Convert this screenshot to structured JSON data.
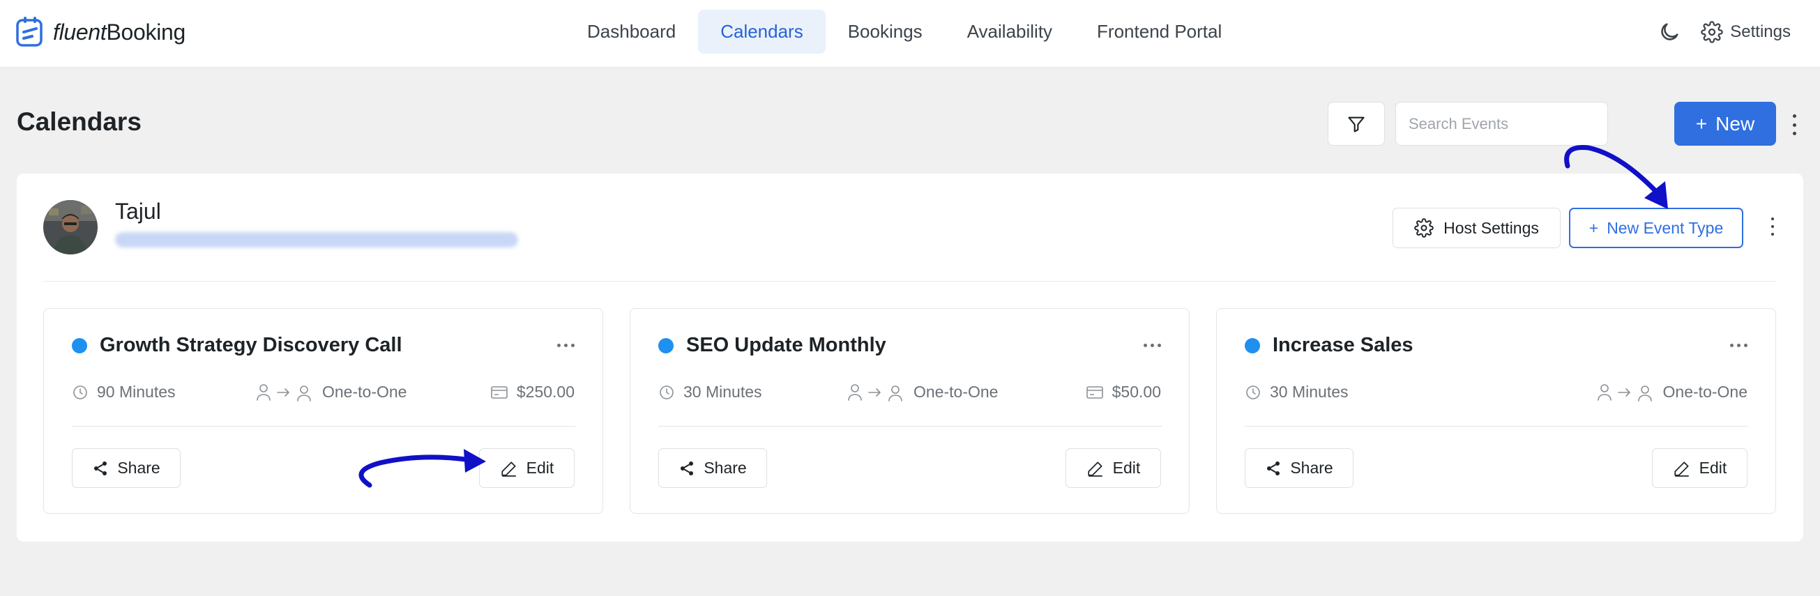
{
  "brand": {
    "name_part1": "fluent",
    "name_part2": "Booking"
  },
  "nav": {
    "items": [
      {
        "label": "Dashboard",
        "active": false
      },
      {
        "label": "Calendars",
        "active": true
      },
      {
        "label": "Bookings",
        "active": false
      },
      {
        "label": "Availability",
        "active": false
      },
      {
        "label": "Frontend Portal",
        "active": false
      }
    ],
    "settings_label": "Settings"
  },
  "page": {
    "title": "Calendars",
    "search_placeholder": "Search Events",
    "new_label": "New"
  },
  "host": {
    "name": "Tajul",
    "host_settings_label": "Host Settings",
    "new_event_type_label": "New Event Type"
  },
  "events": [
    {
      "title": "Growth Strategy Discovery Call",
      "duration": "90 Minutes",
      "type": "One-to-One",
      "price": "$250.00",
      "share_label": "Share",
      "edit_label": "Edit"
    },
    {
      "title": "SEO Update Monthly",
      "duration": "30 Minutes",
      "type": "One-to-One",
      "price": "$50.00",
      "share_label": "Share",
      "edit_label": "Edit"
    },
    {
      "title": "Increase Sales",
      "duration": "30 Minutes",
      "type": "One-to-One",
      "price": "",
      "share_label": "Share",
      "edit_label": "Edit"
    }
  ],
  "colors": {
    "accent": "#2f6fe0",
    "event_dot": "#1e90ef",
    "annotation_arrow": "#1010c8"
  },
  "icons": [
    "calendar-logo-icon",
    "moon-icon",
    "gear-icon",
    "filter-icon",
    "search-icon",
    "plus-icon",
    "kebab-icon",
    "clock-icon",
    "user-to-user-icon",
    "credit-card-icon",
    "share-icon",
    "pencil-icon",
    "more-horizontal-icon"
  ]
}
